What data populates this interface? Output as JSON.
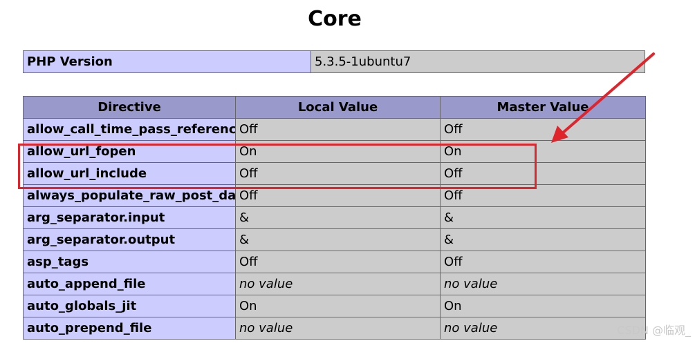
{
  "page": {
    "title": "Core"
  },
  "version": {
    "label": "PHP Version",
    "value": "5.3.5-1ubuntu7"
  },
  "directives": {
    "headers": [
      "Directive",
      "Local Value",
      "Master Value"
    ],
    "rows": [
      {
        "name": "allow_call_time_pass_reference",
        "local": "Off",
        "master": "Off",
        "no_value": false
      },
      {
        "name": "allow_url_fopen",
        "local": "On",
        "master": "On",
        "no_value": false
      },
      {
        "name": "allow_url_include",
        "local": "Off",
        "master": "Off",
        "no_value": false
      },
      {
        "name": "always_populate_raw_post_data",
        "local": "Off",
        "master": "Off",
        "no_value": false
      },
      {
        "name": "arg_separator.input",
        "local": "&",
        "master": "&",
        "no_value": false
      },
      {
        "name": "arg_separator.output",
        "local": "&",
        "master": "&",
        "no_value": false
      },
      {
        "name": "asp_tags",
        "local": "Off",
        "master": "Off",
        "no_value": false
      },
      {
        "name": "auto_append_file",
        "local": "no value",
        "master": "no value",
        "no_value": true
      },
      {
        "name": "auto_globals_jit",
        "local": "On",
        "master": "On",
        "no_value": false
      },
      {
        "name": "auto_prepend_file",
        "local": "no value",
        "master": "no value",
        "no_value": true
      }
    ]
  },
  "annotation": {
    "highlight_color": "#e0242b"
  },
  "watermark": {
    "text": "CSDN @临观_"
  },
  "colors": {
    "header_bg": "#9999cc",
    "directive_bg": "#ccccff",
    "value_bg": "#cccccc"
  }
}
